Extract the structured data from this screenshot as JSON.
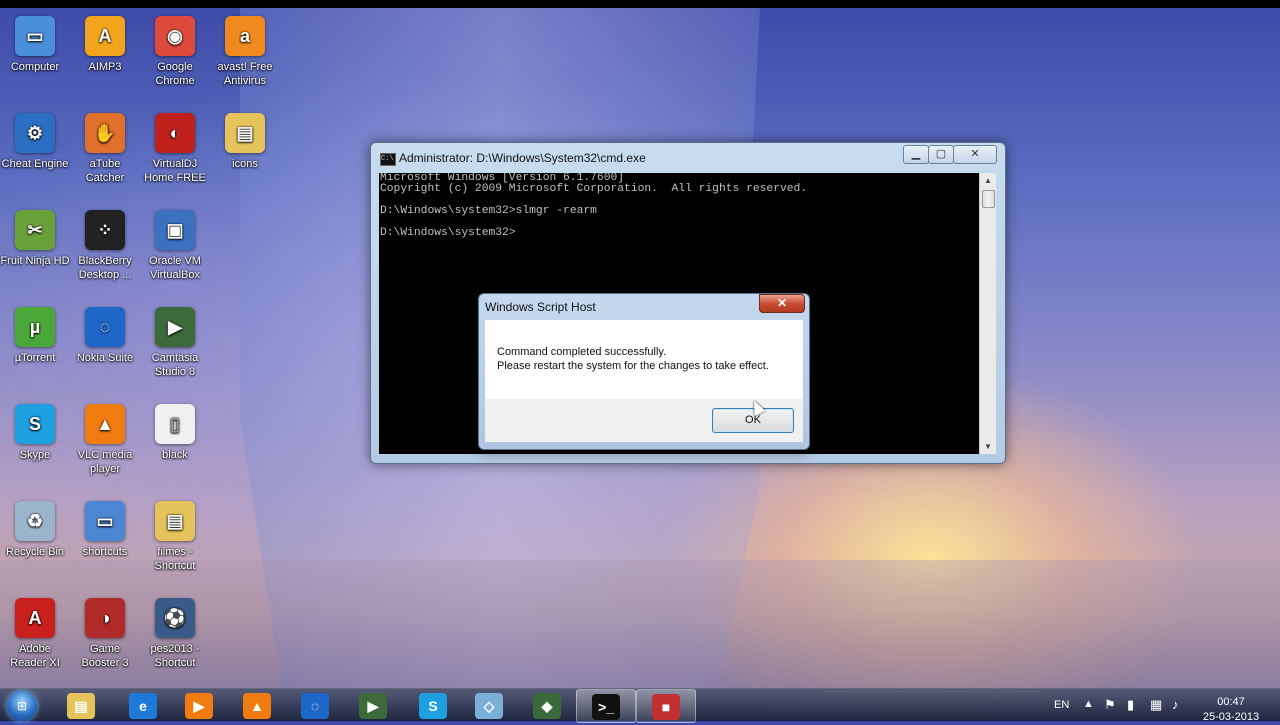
{
  "desktop": {
    "icons": [
      {
        "label": "Computer",
        "icon": "computer-icon",
        "color": "#4a8fd8",
        "glyph": "▭"
      },
      {
        "label": "AIMP3",
        "icon": "aimp3-icon",
        "color": "#f2a51c",
        "glyph": "A"
      },
      {
        "label": "Google Chrome",
        "icon": "chrome-icon",
        "color": "#de4a3c",
        "glyph": "◉"
      },
      {
        "label": "avast! Free Antivirus",
        "icon": "avast-icon",
        "color": "#f08a1c",
        "glyph": "a"
      },
      {
        "label": "Cheat Engine",
        "icon": "cheat-engine-icon",
        "color": "#2a6fc2",
        "glyph": "⚙"
      },
      {
        "label": "aTube Catcher",
        "icon": "atube-catcher-icon",
        "color": "#e0702a",
        "glyph": "✋"
      },
      {
        "label": "VirtualDJ Home FREE",
        "icon": "virtualdj-icon",
        "color": "#c0201c",
        "glyph": "◐"
      },
      {
        "label": "icons",
        "icon": "folder-icon",
        "color": "#e6c35a",
        "glyph": "▤"
      },
      {
        "label": "Fruit Ninja HD",
        "icon": "fruit-ninja-icon",
        "color": "#6aa03a",
        "glyph": "✂"
      },
      {
        "label": "BlackBerry Desktop ...",
        "icon": "blackberry-icon",
        "color": "#222222",
        "glyph": "⁘"
      },
      {
        "label": "Oracle VM VirtualBox",
        "icon": "virtualbox-icon",
        "color": "#3a72c0",
        "glyph": "▣"
      },
      {
        "label": "µTorrent",
        "icon": "utorrent-icon",
        "color": "#4aa83a",
        "glyph": "µ"
      },
      {
        "label": "Nokia Suite",
        "icon": "nokia-suite-icon",
        "color": "#1e66c8",
        "glyph": "◌"
      },
      {
        "label": "Camtasia Studio 8",
        "icon": "camtasia-icon",
        "color": "#3d6a3a",
        "glyph": "▶"
      },
      {
        "label": "Skype",
        "icon": "skype-icon",
        "color": "#1ea0e0",
        "glyph": "S"
      },
      {
        "label": "VLC media player",
        "icon": "vlc-icon",
        "color": "#f07c10",
        "glyph": "▲"
      },
      {
        "label": "black",
        "icon": "text-file-icon",
        "color": "#f0f0f0",
        "glyph": "▯"
      },
      {
        "label": "Recycle Bin",
        "icon": "recycle-bin-icon",
        "color": "#9ab4cc",
        "glyph": "♻"
      },
      {
        "label": "shortcuts",
        "icon": "shortcuts-icon",
        "color": "#4a86d4",
        "glyph": "▭"
      },
      {
        "label": "filmes - Shortcut",
        "icon": "folder-shortcut-icon",
        "color": "#e6c35a",
        "glyph": "▤"
      },
      {
        "label": "Adobe Reader XI",
        "icon": "adobe-reader-icon",
        "color": "#c8201c",
        "glyph": "A"
      },
      {
        "label": "Game Booster 3",
        "icon": "game-booster-icon",
        "color": "#b02a2a",
        "glyph": "◑"
      },
      {
        "label": "pes2013 - Shortcut",
        "icon": "pes2013-icon",
        "color": "#3a5a8a",
        "glyph": "⚽"
      }
    ]
  },
  "cmd_window": {
    "title": "Administrator: D:\\Windows\\System32\\cmd.exe",
    "lines": [
      "Microsoft Windows [Version 6.1.7600]",
      "Copyright (c) 2009 Microsoft Corporation.  All rights reserved.",
      "",
      "D:\\Windows\\system32>slmgr -rearm",
      "",
      "D:\\Windows\\system32>"
    ],
    "minimize": "▁",
    "maximize": "▢",
    "close": "✕"
  },
  "dialog": {
    "title": "Windows Script Host",
    "message_line1": "Command completed successfully.",
    "message_line2": "Please restart the system for the changes to take effect.",
    "ok_label": "OK",
    "close": "✕"
  },
  "taskbar": {
    "start_icon": "windows-start-orb",
    "items": [
      {
        "name": "explorer",
        "icon": "explorer-folder-icon",
        "color": "#e6c35a",
        "glyph": "▤"
      },
      {
        "name": "internet-explorer",
        "icon": "internet-explorer-icon",
        "color": "#1e7ad8",
        "glyph": "e"
      },
      {
        "name": "media-player",
        "icon": "media-player-icon",
        "color": "#f07c10",
        "glyph": "▶"
      },
      {
        "name": "vlc",
        "icon": "vlc-icon",
        "color": "#f07c10",
        "glyph": "▲"
      },
      {
        "name": "nokia-suite",
        "icon": "nokia-suite-icon",
        "color": "#1e66c8",
        "glyph": "◌"
      },
      {
        "name": "camtasia",
        "icon": "camtasia-icon",
        "color": "#3d6a3a",
        "glyph": "▶"
      },
      {
        "name": "skype",
        "icon": "skype-icon",
        "color": "#1ea0e0",
        "glyph": "S"
      },
      {
        "name": "tablet",
        "icon": "tablet-icon",
        "color": "#7ab0d8",
        "glyph": "◇"
      },
      {
        "name": "game",
        "icon": "game-icon",
        "color": "#3a6a3a",
        "glyph": "◆"
      },
      {
        "name": "cmd",
        "icon": "cmd-icon",
        "color": "#111111",
        "glyph": ">_"
      },
      {
        "name": "paint",
        "icon": "paint-icon",
        "color": "#c03030",
        "glyph": "■"
      }
    ],
    "language": "EN",
    "time": "00:47",
    "date": "25-03-2013"
  }
}
